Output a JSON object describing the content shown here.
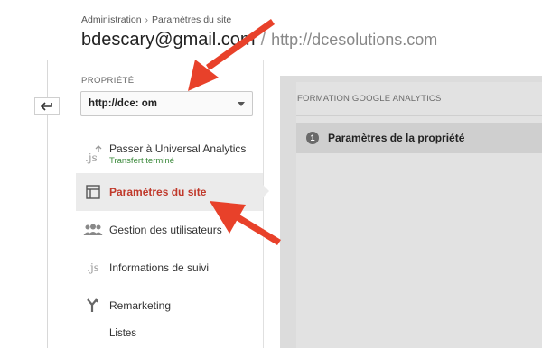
{
  "header": {
    "breadcrumb": [
      "Administration",
      "Paramètres du site"
    ],
    "breadcrumb_separator": "›",
    "account_email": "bdescary@gmail.com",
    "title_separator": "/",
    "account_url": "http://dcesolutions.com"
  },
  "sidebar": {
    "property_label": "PROPRIÉTÉ",
    "property_value": "http://dce:          om",
    "items": [
      {
        "label": "Passer à Universal Analytics",
        "sublabel": "Transfert terminé",
        "icon": "js-upgrade-icon"
      },
      {
        "label": "Paramètres du site",
        "icon": "site-settings-icon",
        "active": true
      },
      {
        "label": "Gestion des utilisateurs",
        "icon": "users-icon"
      },
      {
        "label": "Informations de suivi",
        "icon": "js-icon"
      },
      {
        "label": "Remarketing",
        "icon": "remarketing-icon"
      }
    ],
    "sub_item": "Listes"
  },
  "content": {
    "section_title": "FORMATION GOOGLE ANALYTICS",
    "steps": [
      {
        "number": "1",
        "label": "Paramètres de la propriété"
      }
    ]
  },
  "colors": {
    "active_text": "#c0392b",
    "success_text": "#3c8a3c",
    "annotation_arrow": "#e8412a"
  }
}
